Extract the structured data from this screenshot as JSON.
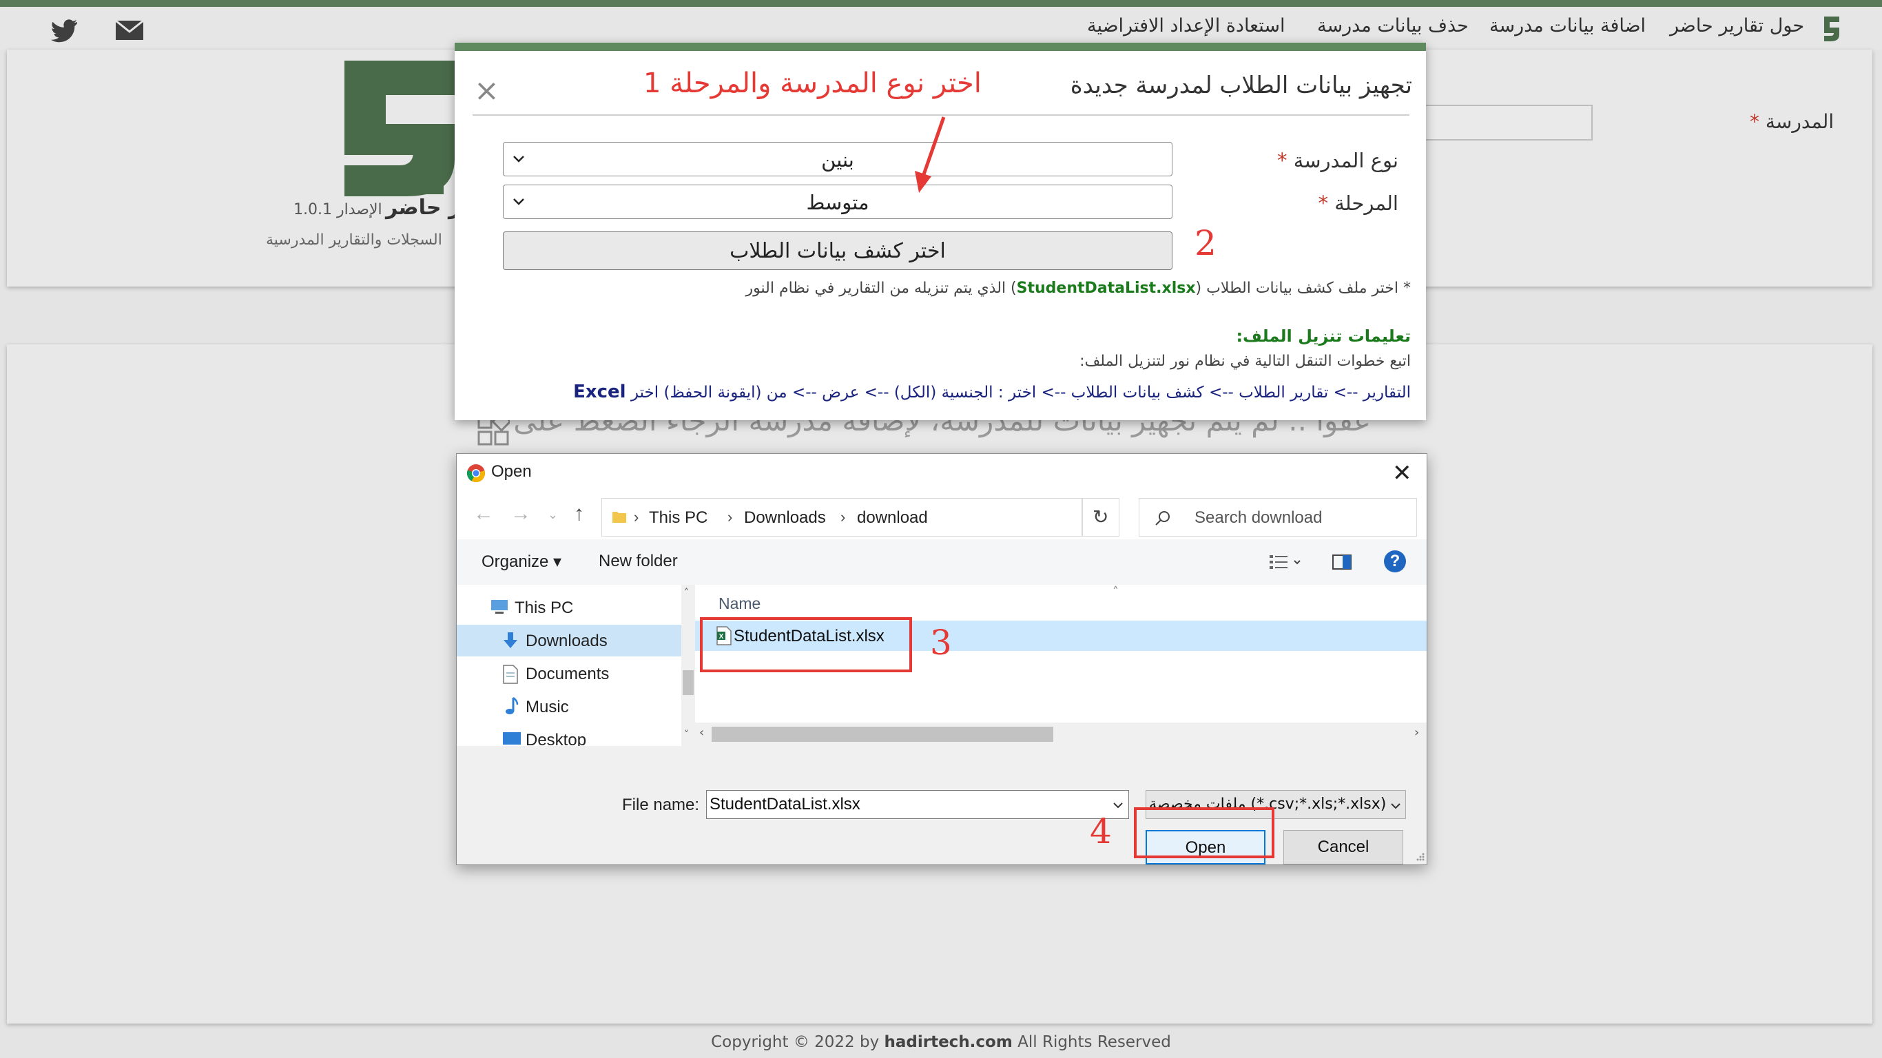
{
  "navbar": {
    "links": [
      "حول تقارير حاضر",
      "اضافة بيانات مدرسة",
      "حذف بيانات مدرسة",
      "استعادة الإعداد الافتراضية"
    ]
  },
  "header": {
    "app_name": "تقارير حاضر",
    "version": "الإصدار 1.0.1",
    "tagline": "السجلات والتقارير المدرسية",
    "school_label": "المدرسة"
  },
  "content": {
    "no_data_message": "عفوا .. لم يتم تجهيز بيانات للمدرسة، لإضافة مدرسة الرجاء الضغط على"
  },
  "modal": {
    "title": "تجهيز بيانات الطلاب لمدرسة جديدة",
    "school_type_label": "نوع المدرسة",
    "school_type_value": "بنين",
    "stage_label": "المرحلة",
    "stage_value": "متوسط",
    "file_button_label": "اختر كشف بيانات الطلاب",
    "note_prefix": "* اختر ملف كشف بيانات الطلاب (",
    "note_file": "StudentDataList.xlsx",
    "note_suffix": ") الذي يتم تنزيله من التقارير في نظام النور",
    "instructions_title": "تعليمات تنزيل الملف:",
    "instructions_intro": "اتبع خطوات التنقل التالية في نظام نور لتنزيل الملف:",
    "instructions_path": "التقارير --> تقارير الطلاب --> كشف بيانات الطلاب --> اختر : الجنسية (الكل) --> عرض --> من (ايقونة الحفظ) اختر",
    "instructions_excel": "Excel"
  },
  "annotations": {
    "step1": "1 اختر نوع المدرسة والمرحلة",
    "step2": "2",
    "step3": "3",
    "step4": "4"
  },
  "dialog": {
    "title": "Open",
    "breadcrumb": [
      "This PC",
      "Downloads",
      "download"
    ],
    "search_placeholder": "Search download",
    "organize_label": "Organize",
    "new_folder_label": "New folder",
    "nav_items": [
      "This PC",
      "Downloads",
      "Documents",
      "Music",
      "Desktop"
    ],
    "column_name": "Name",
    "file_name": "StudentDataList.xlsx",
    "file_name_label": "File name:",
    "file_name_value": "StudentDataList.xlsx",
    "file_type_value": "ملفات مخصصة (*.csv;*.xls;*.xlsx)",
    "open_label": "Open",
    "cancel_label": "Cancel"
  },
  "footer": {
    "prefix": "Copyright © 2022 by ",
    "site": "hadirtech.com",
    "suffix": " All Rights Reserved"
  },
  "colors": {
    "brand_green": "#4a6b4a",
    "annotation_red": "#e53935",
    "note_green": "#1b7a1b",
    "instructions_navy": "#1a237e"
  }
}
